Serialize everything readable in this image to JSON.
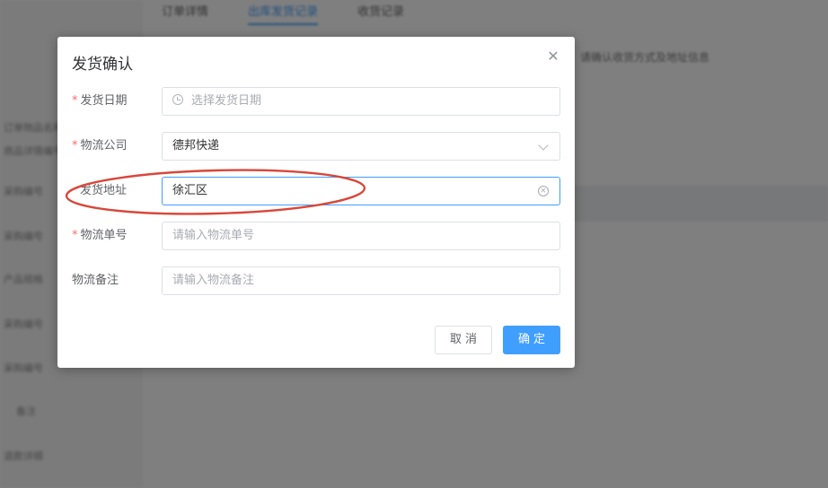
{
  "background": {
    "tabs": [
      "订单详情",
      "出库发货记录",
      "收货记录"
    ],
    "sidebar_items": [
      "订单物品名称",
      "商品详情编号",
      "采购编号",
      "采购编号",
      "产品规格",
      "采购编号",
      "采购编号",
      "备注",
      "退款详细"
    ],
    "main_lines": [
      "请确认收货方式及地址信息"
    ]
  },
  "dialog": {
    "title": "发货确认",
    "close_icon": "close-icon",
    "fields": {
      "ship_date": {
        "label": "发货日期",
        "required": true,
        "placeholder": "选择发货日期",
        "value": ""
      },
      "logistics_company": {
        "label": "物流公司",
        "required": true,
        "value": "德邦快递"
      },
      "ship_address": {
        "label": "发货地址",
        "required": false,
        "value": "徐汇区"
      },
      "tracking_no": {
        "label": "物流单号",
        "required": true,
        "placeholder": "请输入物流单号",
        "value": ""
      },
      "logistics_note": {
        "label": "物流备注",
        "required": false,
        "placeholder": "请输入物流备注",
        "value": ""
      }
    },
    "required_mark": "*",
    "cancel_label": "取消",
    "confirm_label": "确定"
  },
  "colors": {
    "primary": "#409eff",
    "required": "#f56c6c",
    "annotation": "#d9473a"
  }
}
